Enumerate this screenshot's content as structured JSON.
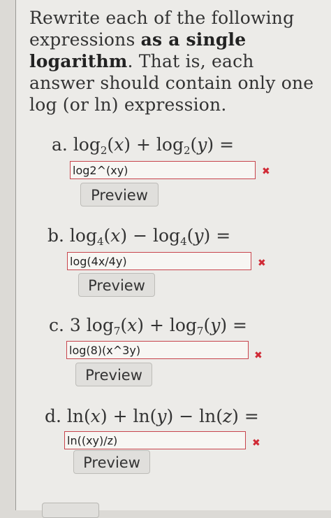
{
  "instructions": {
    "part1": "Rewrite each of the following expressions ",
    "bold": "as a single logarithm",
    "part2": ". That is, each answer should contain only one log (or ln) expression."
  },
  "problems": [
    {
      "letter": "a.",
      "coef": "",
      "fn1": "log",
      "base1": "2",
      "op": "+",
      "fn2": "log",
      "base2": "2",
      "op2": "",
      "fn3": "",
      "var3": "",
      "answer": "log2^(xy)",
      "status": "incorrect",
      "preview_label": "Preview"
    },
    {
      "letter": "b.",
      "coef": "",
      "fn1": "log",
      "base1": "4",
      "op": "−",
      "fn2": "log",
      "base2": "4",
      "op2": "",
      "fn3": "",
      "var3": "",
      "answer": "log(4x/4y)",
      "status": "incorrect",
      "preview_label": "Preview"
    },
    {
      "letter": "c.",
      "coef": "3",
      "fn1": "log",
      "base1": "7",
      "op": "+",
      "fn2": "log",
      "base2": "7",
      "op2": "",
      "fn3": "",
      "var3": "",
      "answer": "log(8)(x^3y)",
      "status": "incorrect",
      "preview_label": "Preview"
    },
    {
      "letter": "d.",
      "coef": "",
      "fn1": "ln",
      "base1": "",
      "op": "+",
      "fn2": "ln",
      "base2": "",
      "op2": "−",
      "fn3": "ln",
      "var3": "z",
      "answer": "ln((xy)/z)",
      "status": "incorrect",
      "preview_label": "Preview"
    }
  ],
  "vars": {
    "x": "x",
    "y": "y"
  },
  "colors": {
    "error": "#d02a35",
    "field_border": "#c8454d"
  },
  "icons": {
    "status": "x-mark-icon"
  }
}
